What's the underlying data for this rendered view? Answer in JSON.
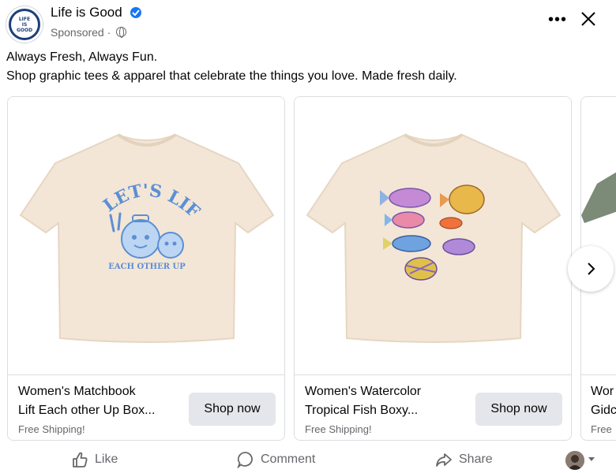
{
  "post": {
    "page_name": "Life is Good",
    "sponsored_label": "Sponsored",
    "separator": "·",
    "logo_lines": [
      "LIFE",
      "IS",
      "GOOD"
    ],
    "body_line1": "Always Fresh, Always Fun.",
    "body_line2": "Shop graphic tees & apparel that celebrate the things you love. Made fresh daily."
  },
  "header_icons": {
    "more": "more-options-icon",
    "close": "close-icon",
    "verified": "verified-badge-icon",
    "audience": "globe-icon"
  },
  "cards": [
    {
      "title_line1": "Women's Matchbook",
      "title_line2": "Lift Each other Up Box...",
      "shipping": "Free Shipping!",
      "cta": "Shop now",
      "graphic_text_top": "LET'S LIFT",
      "graphic_text_bottom": "EACH OTHER UP"
    },
    {
      "title_line1": "Women's Watercolor",
      "title_line2": "Tropical Fish Boxy...",
      "shipping": "Free Shipping!",
      "cta": "Shop now"
    },
    {
      "title_line1": "Wor",
      "title_line2": "Gidc",
      "shipping": "Free"
    }
  ],
  "actions": {
    "like": "Like",
    "comment": "Comment",
    "share": "Share"
  },
  "colors": {
    "tee": "#f3e6d6",
    "tee_shadow": "#e6d6c2",
    "brand_blue": "#1877f2",
    "logo_navy": "#1d3f7a",
    "button_grey": "#e4e6eb",
    "secondary_text": "#65676b",
    "peek_tee": "#7c8a78"
  }
}
